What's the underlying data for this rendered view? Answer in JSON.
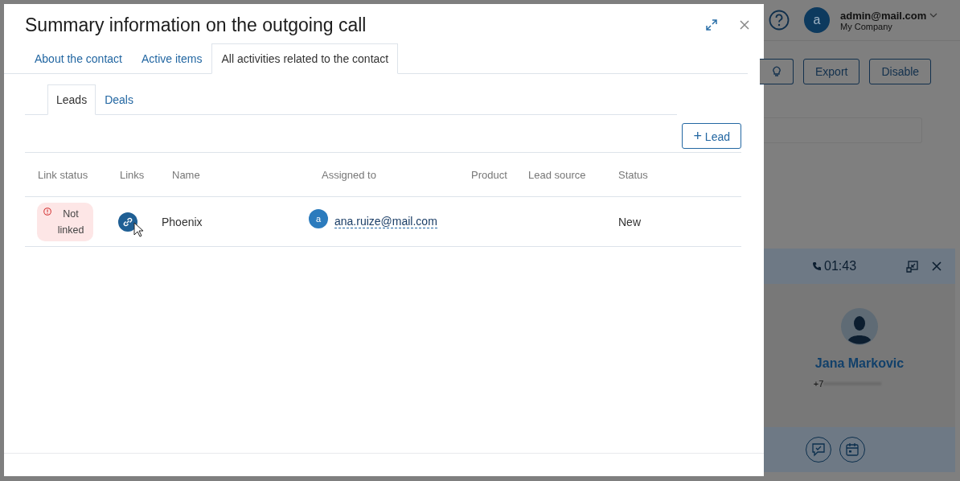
{
  "modal": {
    "title": "Summary information on the outgoing call",
    "tabs": [
      {
        "label": "About the contact",
        "selected": false
      },
      {
        "label": "Active items",
        "selected": false
      },
      {
        "label": "All activities related to the contact",
        "selected": true
      }
    ],
    "subtabs": [
      {
        "label": "Leads",
        "selected": true
      },
      {
        "label": "Deals",
        "selected": false
      }
    ],
    "add_button": {
      "icon": "+",
      "label": "Lead"
    },
    "table": {
      "columns": [
        "Link status",
        "Links",
        "Name",
        "Assigned to",
        "Product",
        "Lead source",
        "Status"
      ],
      "rows": [
        {
          "link_status": {
            "label": "Not linked",
            "kind": "error"
          },
          "name": "Phoenix",
          "assignee": {
            "avatar": "a",
            "email": "ana.ruize@mail.com"
          },
          "product": "",
          "lead_source": "",
          "status": "New"
        }
      ]
    }
  },
  "header": {
    "user": {
      "avatar": "a",
      "email": "admin@mail.com",
      "company": "My Company"
    }
  },
  "toolbar": {
    "buttons": [
      "Export",
      "Disable"
    ]
  },
  "call_widget": {
    "timer": "01:43",
    "contact_name": "Jana Markovic",
    "phone": "+7"
  }
}
